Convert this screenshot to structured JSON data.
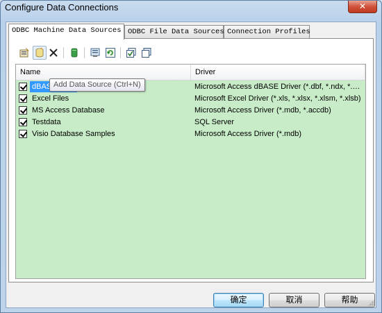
{
  "window": {
    "title": "Configure Data Connections",
    "close_label": "✕"
  },
  "tabs": [
    {
      "label": "ODBC Machine Data Sources",
      "active": true
    },
    {
      "label": "ODBC File Data Sources",
      "active": false
    },
    {
      "label": "Connection Profiles",
      "active": false
    }
  ],
  "toolbar": {
    "buttons": [
      {
        "icon": "properties-icon"
      },
      {
        "icon": "add-data-source-icon"
      },
      {
        "icon": "delete-icon"
      },
      {
        "icon": "database-icon"
      },
      {
        "icon": "configure-icon"
      },
      {
        "icon": "refresh-icon"
      },
      {
        "icon": "check-all-icon"
      },
      {
        "icon": "copy-icon"
      }
    ],
    "tooltip": "Add Data Source (Ctrl+N)"
  },
  "list": {
    "columns": [
      "Name",
      "Driver"
    ],
    "background": "#c8ecc8",
    "rows": [
      {
        "name": "dBASE Files",
        "driver": "Microsoft Access dBASE Driver (*.dbf, *.ndx, *.m...",
        "checked": true,
        "selected": true
      },
      {
        "name": "Excel Files",
        "driver": "Microsoft Excel Driver (*.xls, *.xlsx, *.xlsm, *.xlsb)",
        "checked": true,
        "selected": false
      },
      {
        "name": "MS Access Database",
        "driver": "Microsoft Access Driver (*.mdb, *.accdb)",
        "checked": true,
        "selected": false
      },
      {
        "name": "Testdata",
        "driver": "SQL Server",
        "checked": true,
        "selected": false
      },
      {
        "name": "Visio Database Samples",
        "driver": "Microsoft Access Driver (*.mdb)",
        "checked": true,
        "selected": false
      }
    ]
  },
  "footer": {
    "ok_label": "确定",
    "cancel_label": "取消",
    "help_label": "帮助"
  },
  "colors": {
    "selection": "#3399ff",
    "list_bg": "#c8ecc8",
    "close_button": "#c0391f"
  }
}
